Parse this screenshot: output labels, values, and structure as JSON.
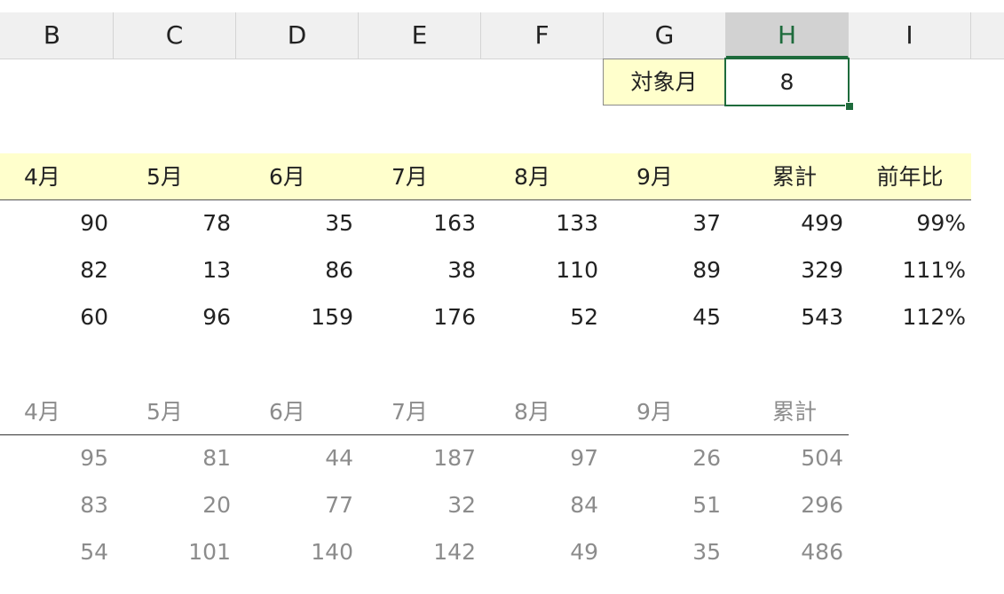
{
  "columns": [
    {
      "label": "B",
      "selected": false
    },
    {
      "label": "C",
      "selected": false
    },
    {
      "label": "D",
      "selected": false
    },
    {
      "label": "E",
      "selected": false
    },
    {
      "label": "F",
      "selected": false
    },
    {
      "label": "G",
      "selected": false
    },
    {
      "label": "H",
      "selected": true
    },
    {
      "label": "I",
      "selected": false
    }
  ],
  "selector": {
    "label": "対象月",
    "value": "8"
  },
  "current_table": {
    "headers": [
      "4月",
      "5月",
      "6月",
      "7月",
      "8月",
      "9月",
      "累計",
      "前年比"
    ],
    "rows": [
      [
        "90",
        "78",
        "35",
        "163",
        "133",
        "37",
        "499",
        "99%"
      ],
      [
        "82",
        "13",
        "86",
        "38",
        "110",
        "89",
        "329",
        "111%"
      ],
      [
        "60",
        "96",
        "159",
        "176",
        "52",
        "45",
        "543",
        "112%"
      ]
    ]
  },
  "previous_table": {
    "headers": [
      "4月",
      "5月",
      "6月",
      "7月",
      "8月",
      "9月",
      "累計"
    ],
    "rows": [
      [
        "95",
        "81",
        "44",
        "187",
        "97",
        "26",
        "504"
      ],
      [
        "83",
        "20",
        "77",
        "32",
        "84",
        "51",
        "296"
      ],
      [
        "54",
        "101",
        "140",
        "142",
        "49",
        "35",
        "486"
      ]
    ]
  },
  "colors": {
    "header_fill": "#ffffcc",
    "accent_green": "#1e6b3c",
    "muted_text": "#8c8c8c"
  }
}
